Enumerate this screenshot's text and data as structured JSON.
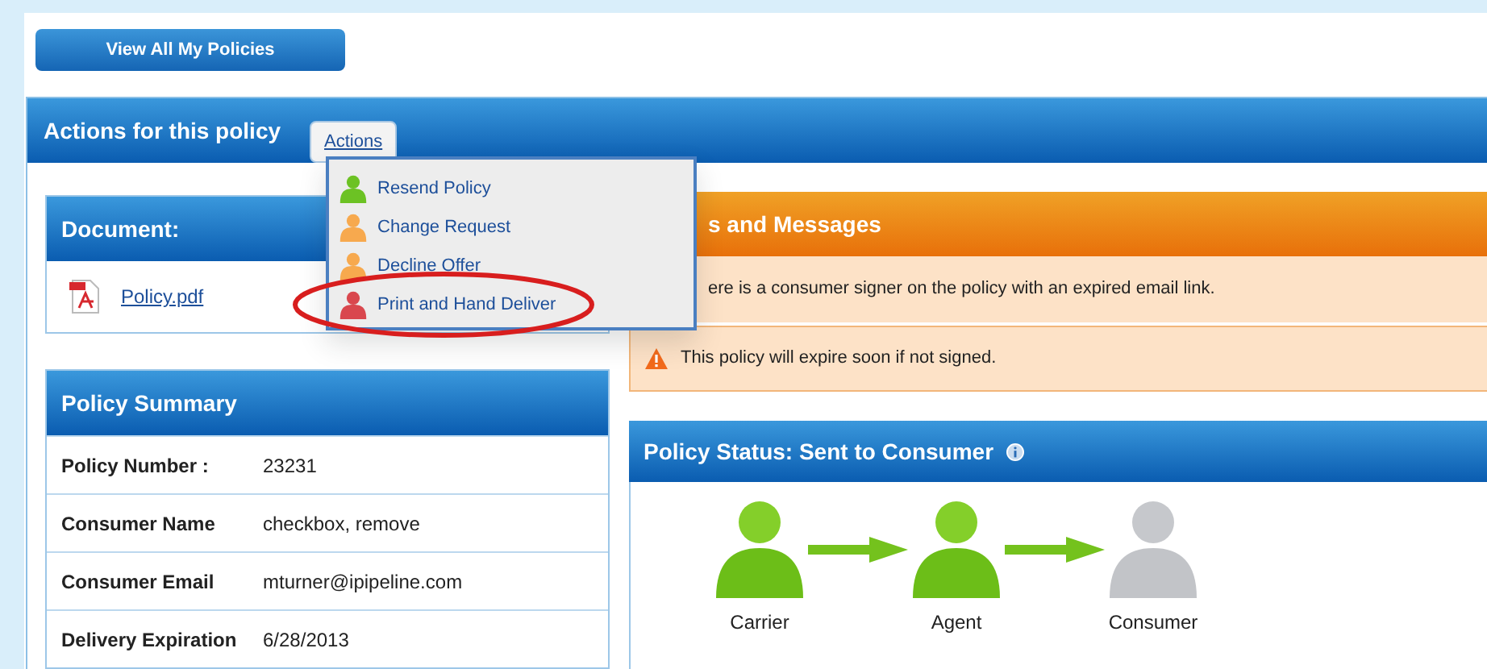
{
  "top_button": "View All My Policies",
  "actions_panel": {
    "title": "Actions for this policy",
    "menu_button": "Actions",
    "menu_open": true,
    "menu_items": [
      {
        "label": "Resend Policy",
        "color": "#6cc224",
        "circled": false
      },
      {
        "label": "Change Request",
        "color": "#f7a94e",
        "circled": false
      },
      {
        "label": "Decline Offer",
        "color": "#f7a94e",
        "circled": false
      },
      {
        "label": "Print and Hand Deliver",
        "color": "#d9474e",
        "circled": true
      }
    ]
  },
  "document": {
    "title": "Document:",
    "file": "Policy.pdf"
  },
  "summary": {
    "title": "Policy Summary",
    "rows": [
      {
        "label": "Policy Number :",
        "value": "23231"
      },
      {
        "label": "Consumer Name",
        "value": "checkbox, remove"
      },
      {
        "label": "Consumer Email",
        "value": "mturner@ipipeline.com"
      },
      {
        "label": "Delivery Expiration",
        "value": "6/28/2013"
      }
    ]
  },
  "messages": {
    "title": "s and Messages",
    "items": [
      {
        "text": "ere is a consumer signer on the policy with an expired email link.",
        "warning_icon": false
      },
      {
        "text": "This policy will expire soon if not signed.",
        "warning_icon": true
      }
    ]
  },
  "status": {
    "title": "Policy Status: Sent to Consumer",
    "steps": [
      {
        "label": "Carrier",
        "completed": true
      },
      {
        "label": "Agent",
        "completed": true
      },
      {
        "label": "Consumer",
        "completed": false
      }
    ]
  }
}
